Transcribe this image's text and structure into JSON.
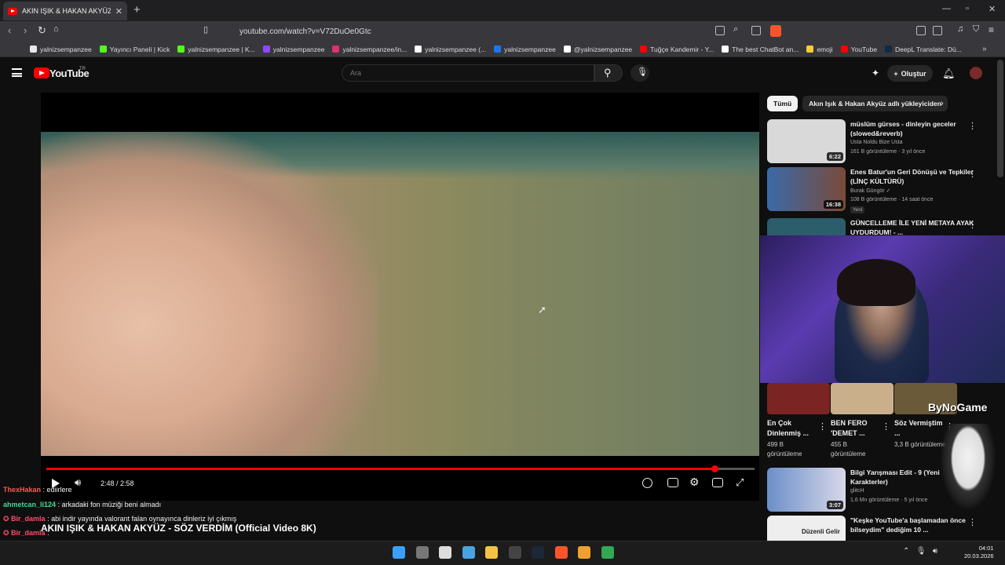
{
  "tab": {
    "title": "AKIN IŞIK & HAKAN AKYÜZ",
    "close": "✕",
    "new": "+"
  },
  "window": {
    "min": "—",
    "max": "▫",
    "close": "✕"
  },
  "address": {
    "url": "youtube.com/watch?v=V72DuOe0Gtc"
  },
  "bookmarks": [
    {
      "label": "yalnizsempanzee",
      "color": "#e8e8e8"
    },
    {
      "label": "Yayıncı Paneli | Kick",
      "color": "#53fc18"
    },
    {
      "label": "yalnizsempanzee | K...",
      "color": "#53fc18"
    },
    {
      "label": "yalnizsempanzee",
      "color": "#9146ff"
    },
    {
      "label": "yalnizsempanzee/in...",
      "color": "#e1306c"
    },
    {
      "label": "yalnizsempanzee (...",
      "color": "#ffffff"
    },
    {
      "label": "yalnizsempanzee",
      "color": "#1877f2"
    },
    {
      "label": "@yalnizsempanzee",
      "color": "#ffffff"
    },
    {
      "label": "Tuğçe Kandemir - Y...",
      "color": "#ff0000"
    },
    {
      "label": "The best ChatBot an...",
      "color": "#ffffff"
    },
    {
      "label": "emoji",
      "color": "#ffcc33"
    },
    {
      "label": "YouTube",
      "color": "#ff0000"
    },
    {
      "label": "DeepL Translate: Dü...",
      "color": "#0f2b46"
    }
  ],
  "yt": {
    "logo": "YouTube",
    "country": "TR",
    "search_placeholder": "Ara",
    "create": "Oluştur"
  },
  "player": {
    "time": "2:48 / 2:58",
    "progress_fraction": 0.943,
    "video_title": "AKIN IŞIK & HAKAN AKYÜZ - SÖZ VERDİM (Official Video 8K)"
  },
  "chat": [
    {
      "user": "ThexHakan",
      "color": "#ff5555",
      "text": "ediirlere"
    },
    {
      "user": "ahmetcan_li124",
      "color": "#3ddc97",
      "text": "arkadaki fon müziği beni almadı"
    },
    {
      "user": "Bir_damla",
      "color": "#ff4d6d",
      "text": "abi indir yayında valorant falan oynayınca dinleriz iyi çıkmış"
    },
    {
      "user": "Bir_damla",
      "color": "#ff4d6d",
      "text": ""
    }
  ],
  "chips": [
    {
      "label": "Tümü",
      "active": true
    },
    {
      "label": "Akın Işık & Hakan Akyüz adlı yükleyiciden",
      "active": false
    }
  ],
  "recs": [
    {
      "title": "müslüm gürses - dinleyin geceler (slowed&reverb)",
      "channel": "Usta Noldu Bize Usta",
      "meta": "161 B görüntüleme · 3 yıl önce",
      "duration": "6:22",
      "badge": "",
      "thumb": "#d9d9d9"
    },
    {
      "title": "Enes Batur'un Geri Dönüşü ve Tepkiler (LİNÇ KÜLTÜRÜ)",
      "channel": "Burak Güngör ✓",
      "meta": "108 B görüntüleme · 14 saat önce",
      "duration": "16:38",
      "badge": "Yeni",
      "thumb": "#3a6aa8"
    },
    {
      "title": "GÜNCELLEME İLE YENİ METAYA AYAK UYDURDUM! - ...",
      "channel": "",
      "meta": "",
      "duration": "",
      "badge": "",
      "thumb": "#2b5d6a"
    }
  ],
  "recs2": [
    {
      "title": "Bilgi Yarışması Edit - 9 (Yeni Karakterler)",
      "channel": "glitcH",
      "meta": "1,6 Mn görüntüleme · 5 yıl önce",
      "duration": "3:07",
      "thumb": "#6b8fc9"
    },
    {
      "title": "\"Keşke YouTube'a başlamadan önce bilseydim\" dediğim 10 ...",
      "channel": "Düzenli Gelir",
      "meta": "",
      "duration": "",
      "thumb": "#eeeeee"
    }
  ],
  "shorts": [
    {
      "title": "En Çok Dinlenmiş ...",
      "views": "499 B görüntüleme",
      "thumb": "#7a2424"
    },
    {
      "title": "BEN FERO 'DEMET ...",
      "views": "455 B görüntüleme",
      "thumb": "#c9b08a"
    },
    {
      "title": "Söz Vermiştim ...",
      "views": "3,3 B görüntüleme",
      "thumb": "#6a5a3a"
    }
  ],
  "overlay": {
    "brand": "ByNoGame"
  },
  "taskbar": {
    "time": "04:01",
    "date": "20.03.2026",
    "icons": [
      {
        "name": "start-icon",
        "color": "#3aa0ff"
      },
      {
        "name": "task-view-icon",
        "color": "#777777"
      },
      {
        "name": "paint-icon",
        "color": "#dddddd"
      },
      {
        "name": "photos-icon",
        "color": "#4aa3df"
      },
      {
        "name": "explorer-icon",
        "color": "#f5c242"
      },
      {
        "name": "obs-icon",
        "color": "#444444"
      },
      {
        "name": "steam-icon",
        "color": "#1b2838"
      },
      {
        "name": "brave-icon",
        "color": "#fb542b"
      },
      {
        "name": "media-icon",
        "color": "#f0a030"
      },
      {
        "name": "chrome-icon",
        "color": "#34a853"
      }
    ]
  }
}
